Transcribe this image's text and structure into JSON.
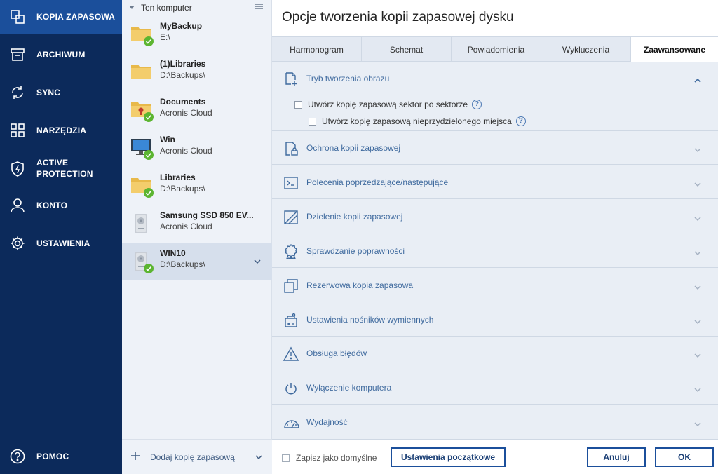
{
  "nav": {
    "items": [
      {
        "label": "KOPIA ZAPASOWA",
        "icon": "backup-copy-icon"
      },
      {
        "label": "ARCHIWUM",
        "icon": "archive-icon"
      },
      {
        "label": "SYNC",
        "icon": "sync-icon"
      },
      {
        "label": "NARZĘDZIA",
        "icon": "tools-grid-icon"
      },
      {
        "label": "ACTIVE",
        "label2": "PROTECTION",
        "icon": "shield-icon"
      },
      {
        "label": "KONTO",
        "icon": "user-icon"
      },
      {
        "label": "USTAWIENIA",
        "icon": "gear-icon"
      }
    ],
    "help": {
      "label": "POMOC",
      "icon": "help-icon"
    }
  },
  "list": {
    "header": "Ten komputer",
    "items": [
      {
        "name": "MyBackup",
        "dest": "E:\\",
        "icon": "folder-icon",
        "status": "ok"
      },
      {
        "name": "(1)Libraries",
        "dest": "D:\\Backups\\",
        "icon": "folder-icon",
        "status": "none"
      },
      {
        "name": "Documents",
        "dest": "Acronis Cloud",
        "icon": "briefcase-folder-icon",
        "status": "ok"
      },
      {
        "name": "Win",
        "dest": "Acronis Cloud",
        "icon": "monitor-icon",
        "status": "ok"
      },
      {
        "name": "Libraries",
        "dest": "D:\\Backups\\",
        "icon": "folder-icon",
        "status": "ok"
      },
      {
        "name": "Samsung SSD 850 EV...",
        "dest": "Acronis Cloud",
        "icon": "disk-icon",
        "status": "none"
      },
      {
        "name": "WIN10",
        "dest": "D:\\Backups\\",
        "icon": "disk-icon",
        "status": "ok"
      }
    ],
    "add_label": "Dodaj kopię zapasową"
  },
  "dialog": {
    "title": "Opcje tworzenia kopii zapasowej dysku",
    "tabs": [
      "Harmonogram",
      "Schemat",
      "Powiadomienia",
      "Wykluczenia",
      "Zaawansowane"
    ],
    "active_tab": "Zaawansowane",
    "sections": [
      {
        "title": "Tryb tworzenia obrazu",
        "icon": "image-mode-icon",
        "expanded": true
      },
      {
        "title": "Ochrona kopii zapasowej",
        "icon": "lock-icon"
      },
      {
        "title": "Polecenia poprzedzające/następujące",
        "icon": "terminal-icon"
      },
      {
        "title": "Dzielenie kopii zapasowej",
        "icon": "split-icon"
      },
      {
        "title": "Sprawdzanie poprawności",
        "icon": "badge-icon"
      },
      {
        "title": "Rezerwowa kopia zapasowa",
        "icon": "copy-icon"
      },
      {
        "title": "Ustawienia nośników wymiennych",
        "icon": "removable-media-icon"
      },
      {
        "title": "Obsługa błędów",
        "icon": "warning-icon"
      },
      {
        "title": "Wyłączenie komputera",
        "icon": "power-icon"
      },
      {
        "title": "Wydajność",
        "icon": "gauge-icon"
      }
    ],
    "image_mode_options": [
      {
        "label": "Utwórz kopię zapasową sektor po sektorze",
        "checked": false
      },
      {
        "label": "Utwórz kopię zapasową nieprzydzielonego miejsca",
        "checked": false
      }
    ],
    "footer": {
      "save_default": "Zapisz jako domyślne",
      "reset": "Ustawienia początkowe",
      "cancel": "Anuluj",
      "ok": "OK"
    }
  },
  "colors": {
    "nav_bg": "#0c2a5b",
    "nav_active": "#1b4f9b",
    "ok_green": "#5cb531",
    "accent": "#3f6a9e"
  }
}
